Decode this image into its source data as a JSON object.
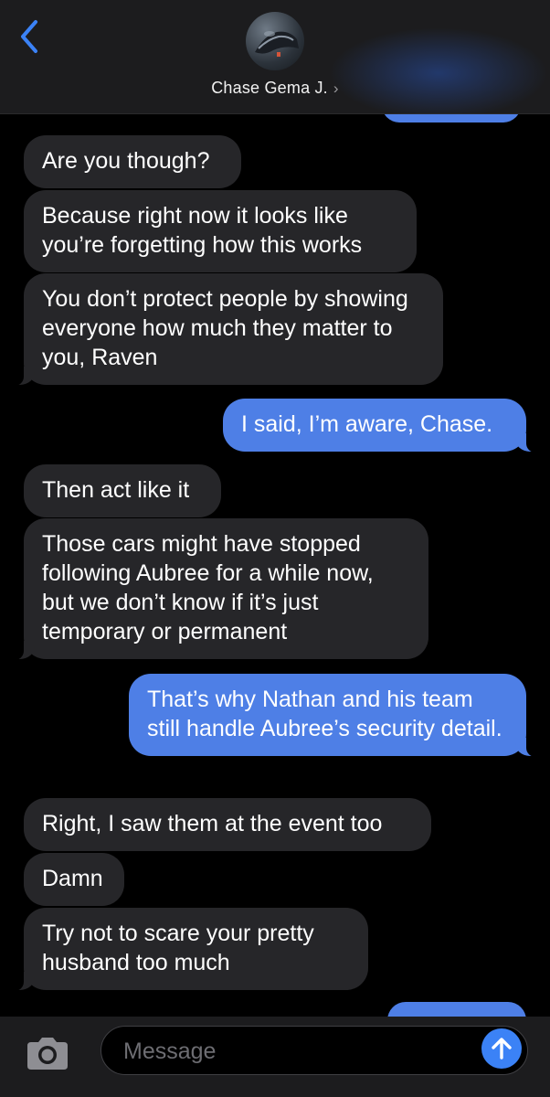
{
  "header": {
    "contact_name": "Chase Gema J.",
    "chevron": "›"
  },
  "messages": [
    {
      "side": "in",
      "text": "Are you though?"
    },
    {
      "side": "in",
      "text": "Because right now it looks like you’re forgetting how this works"
    },
    {
      "side": "in",
      "text": "You don’t protect people by showing everyone how much they matter to you, Raven"
    },
    {
      "side": "out",
      "text": "I said, I’m aware, Chase."
    },
    {
      "side": "in",
      "text": "Then act like it"
    },
    {
      "side": "in",
      "text": "Those cars might have stopped following Aubree for a while now, but we don’t know if it’s just temporary or permanent"
    },
    {
      "side": "out",
      "text": "That’s why Nathan and his team still handle Aubree’s security detail."
    },
    {
      "side": "in",
      "text": "Right, I saw them at the event too"
    },
    {
      "side": "in",
      "text": "Damn"
    },
    {
      "side": "in",
      "text": "Try not to scare your pretty husband too much"
    }
  ],
  "composer": {
    "placeholder": "Message"
  },
  "colors": {
    "incoming_bubble": "#262629",
    "outgoing_bubble": "#4e7fe6",
    "accent": "#3b82f6",
    "background": "#000000"
  },
  "icons": {
    "back": "chevron-left-icon",
    "camera": "camera-icon",
    "send": "arrow-up-icon"
  }
}
